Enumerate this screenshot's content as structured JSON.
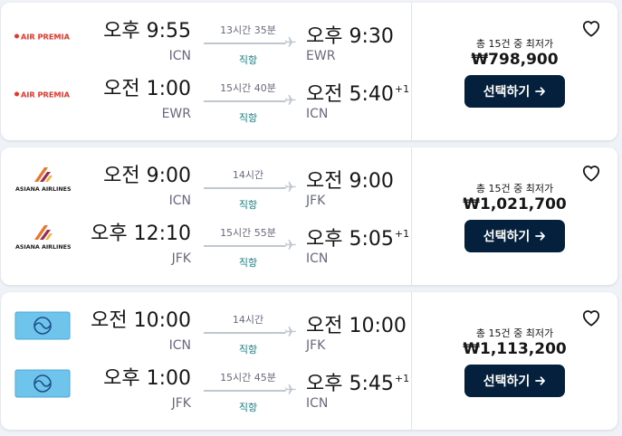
{
  "cards": [
    {
      "airline": "AIR PREMIA",
      "logo_icon": "air-premia-logo-icon",
      "legs": [
        {
          "dep_time": "오후 9:55",
          "dep_code": "ICN",
          "duration": "13시간 35분",
          "stops": "직항",
          "arr_time": "오후 9:30",
          "arr_offset": "",
          "arr_code": "EWR"
        },
        {
          "dep_time": "오전 1:00",
          "dep_code": "EWR",
          "duration": "15시간 40분",
          "stops": "직항",
          "arr_time": "오전 5:40",
          "arr_offset": "+1",
          "arr_code": "ICN"
        }
      ],
      "price_label": "총 15건 중 최저가",
      "price": "₩798,900",
      "button_label": "선택하기"
    },
    {
      "airline": "ASIANA AIRLINES",
      "logo_icon": "asiana-airlines-logo-icon",
      "legs": [
        {
          "dep_time": "오전 9:00",
          "dep_code": "ICN",
          "duration": "14시간",
          "stops": "직항",
          "arr_time": "오전 9:00",
          "arr_offset": "",
          "arr_code": "JFK"
        },
        {
          "dep_time": "오후 12:10",
          "dep_code": "JFK",
          "duration": "15시간 55분",
          "stops": "직항",
          "arr_time": "오후 5:05",
          "arr_offset": "+1",
          "arr_code": "ICN"
        }
      ],
      "price_label": "총 15건 중 최저가",
      "price": "₩1,021,700",
      "button_label": "선택하기"
    },
    {
      "airline": "Korean Air",
      "logo_icon": "korean-air-logo-icon",
      "legs": [
        {
          "dep_time": "오전 10:00",
          "dep_code": "ICN",
          "duration": "14시간",
          "stops": "직항",
          "arr_time": "오전 10:00",
          "arr_offset": "",
          "arr_code": "JFK"
        },
        {
          "dep_time": "오후 1:00",
          "dep_code": "JFK",
          "duration": "15시간 45분",
          "stops": "직항",
          "arr_time": "오후 5:45",
          "arr_offset": "+1",
          "arr_code": "ICN"
        }
      ],
      "price_label": "총 15건 중 최저가",
      "price": "₩1,113,200",
      "button_label": "선택하기"
    }
  ],
  "icons": {
    "heart": "heart-outline-icon",
    "arrow": "arrow-right-icon",
    "plane": "airplane-icon"
  },
  "colors": {
    "button_bg": "#05203c",
    "stops_text": "#0c838a",
    "air_premia_red": "#e6352b",
    "asiana_orange": "#e8772e",
    "korean_air_blue": "#6ec4ea"
  }
}
